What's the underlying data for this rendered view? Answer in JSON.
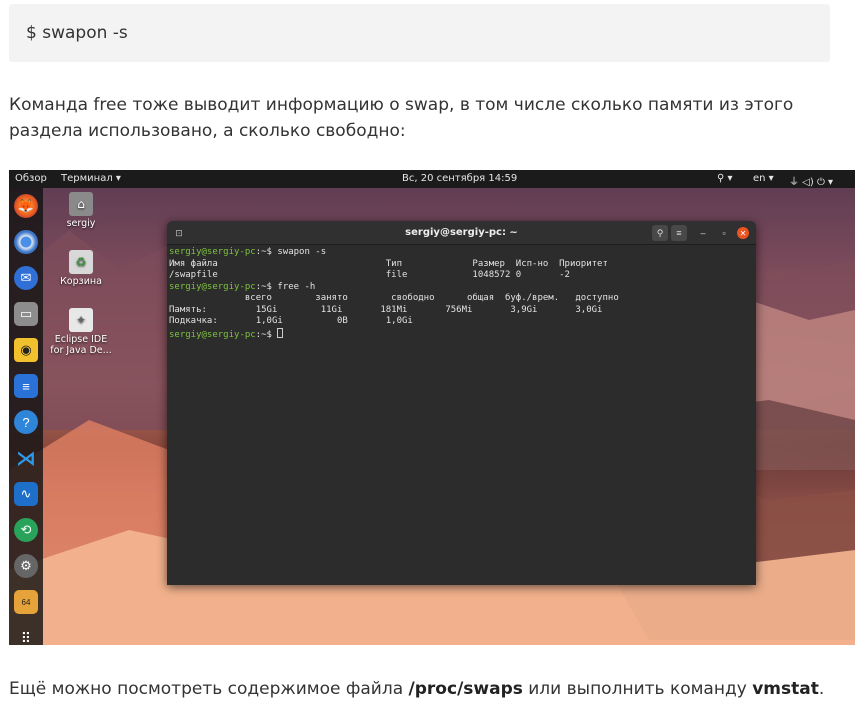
{
  "article": {
    "code_command": "$  swapon -s",
    "para1": "Команда free тоже выводит информацию о swap, в том числе сколько памяти из этого раздела использовано, а сколько свободно:",
    "para2_a": "Ещё можно посмотреть содержимое файла ",
    "para2_file": "/proc/swaps",
    "para2_b": " или выполнить команду ",
    "para2_cmd": "vmstat",
    "para2_c": "."
  },
  "topbar": {
    "activities": "Обзор",
    "app_menu": "Терминал ▾",
    "clock": "Вс, 20 сентября  14:59",
    "accessibility": "⚲ ▾",
    "lang": "en ▾",
    "tray": "⏚  ◁)  ⏻ ▾"
  },
  "desktop": {
    "icons": [
      {
        "label": "sergiy",
        "icon": "home-folder-icon"
      },
      {
        "label": "Корзина",
        "icon": "trash-icon"
      },
      {
        "label": "Eclipse IDE for Java De...",
        "icon": "eclipse-icon"
      }
    ]
  },
  "dock": {
    "apps": [
      "firefox-icon",
      "chromium-icon",
      "thunderbird-icon",
      "files-icon",
      "rhythmbox-icon",
      "libreoffice-writer-icon",
      "help-icon",
      "vscode-icon",
      "system-monitor-icon",
      "software-icon",
      "settings-icon",
      "gnome-64-icon",
      "app-grid-icon"
    ]
  },
  "terminal": {
    "title": "sergiy@sergiy-pc: ~",
    "prompt": "sergiy@sergiy-pc",
    "lines": [
      {
        "prompt": true,
        "text": ":~$ swapon -s"
      },
      {
        "prompt": false,
        "text": "Имя файла                               Тип             Размер  Исп-но  Приоритет"
      },
      {
        "prompt": false,
        "text": "/swapfile                               file            1048572 0       -2"
      },
      {
        "prompt": true,
        "text": ":~$ free -h"
      },
      {
        "prompt": false,
        "text": "              всего        занято        свободно      общая  буф./врем.   доступно"
      },
      {
        "prompt": false,
        "text": "Память:         15Gi        11Gi       181Mi       756Mi       3,9Gi       3,0Gi"
      },
      {
        "prompt": false,
        "text": "Подкачка:       1,0Gi          0B       1,0Gi"
      },
      {
        "prompt": true,
        "text": ":~$ "
      }
    ]
  },
  "colors": {
    "prompt": "#7ec242",
    "close": "#e95420",
    "terminal_bg": "#2c2c2c"
  }
}
